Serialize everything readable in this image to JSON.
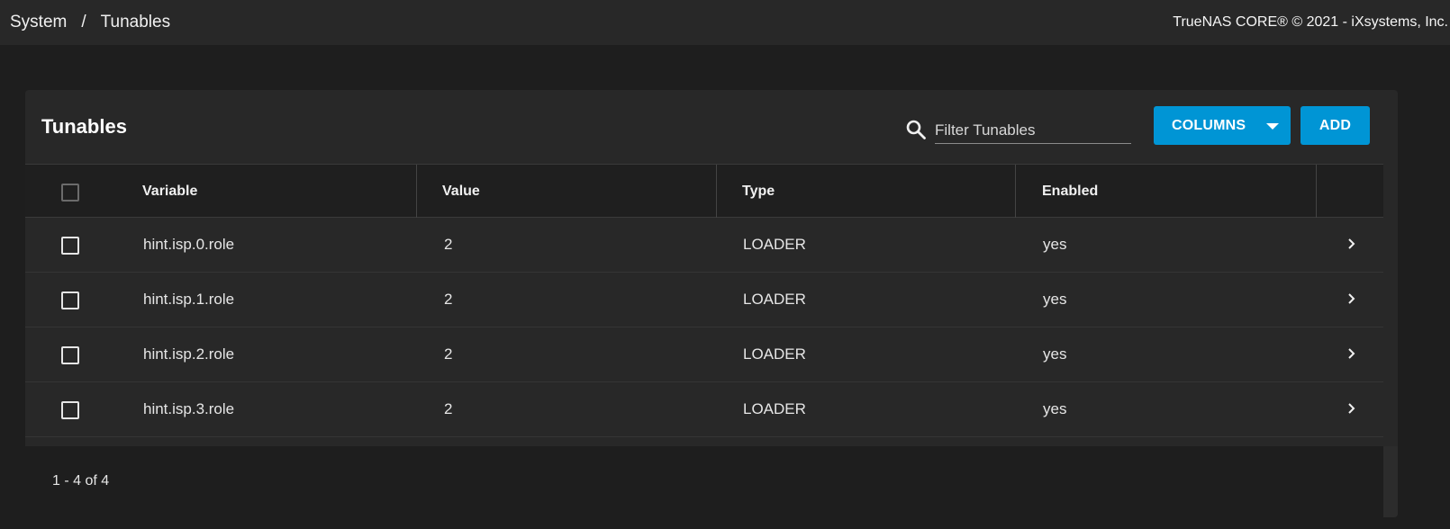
{
  "breadcrumb": {
    "parent": "System",
    "separator": "/",
    "current": "Tunables"
  },
  "copyright": "TrueNAS CORE® © 2021 - iXsystems, Inc.",
  "card": {
    "title": "Tunables",
    "filter_placeholder": "Filter Tunables",
    "columns_label": "COLUMNS",
    "add_label": "ADD"
  },
  "table": {
    "headers": {
      "variable": "Variable",
      "value": "Value",
      "type": "Type",
      "enabled": "Enabled"
    },
    "rows": [
      {
        "variable": "hint.isp.0.role",
        "value": "2",
        "type": "LOADER",
        "enabled": "yes"
      },
      {
        "variable": "hint.isp.1.role",
        "value": "2",
        "type": "LOADER",
        "enabled": "yes"
      },
      {
        "variable": "hint.isp.2.role",
        "value": "2",
        "type": "LOADER",
        "enabled": "yes"
      },
      {
        "variable": "hint.isp.3.role",
        "value": "2",
        "type": "LOADER",
        "enabled": "yes"
      }
    ]
  },
  "pagination": {
    "range": "1 - 4 of 4"
  },
  "colors": {
    "accent": "#0095d5",
    "background": "#1e1e1e",
    "card": "#282828"
  },
  "icons": {
    "search": "search-icon",
    "expand": "chevron-right-icon",
    "menu_caret": "caret-down-icon"
  }
}
